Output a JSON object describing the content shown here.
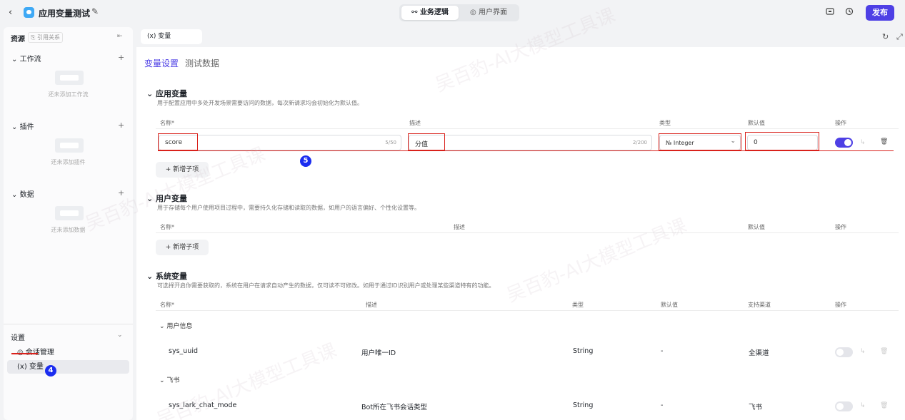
{
  "header": {
    "back_glyph": "‹",
    "app_title": "应用变量测试",
    "edit_glyph": "✎",
    "tabs": [
      {
        "icon": "⚯",
        "label": "业务逻辑"
      },
      {
        "icon": "◎",
        "label": "用户界面"
      }
    ],
    "publish_label": "发布",
    "icons": [
      "cloud-icon",
      "history-icon"
    ]
  },
  "sidebar": {
    "title": "资源",
    "ref_label": "⎘ 引用关系",
    "sections": [
      {
        "label": "工作流",
        "empty_text": "还未添加工作流"
      },
      {
        "label": "插件",
        "empty_text": "还未添加插件"
      },
      {
        "label": "数据",
        "empty_text": "还未添加数据"
      }
    ],
    "settings_title": "设置",
    "settings_items": [
      {
        "icon": "◎",
        "label": "会话管理"
      },
      {
        "icon": "(x)",
        "label": "变量"
      }
    ]
  },
  "badges": {
    "sidebar": "4",
    "row": "5"
  },
  "main": {
    "tab_label": "(x)  变量",
    "subtabs": [
      "变量设置",
      "测试数据"
    ],
    "app_vars": {
      "title": "应用变量",
      "desc": "用于配置应用中多处开发场景需要访问的数据，每次新请求均会初始化为默认值。",
      "columns": [
        "名称*",
        "描述",
        "类型",
        "默认值",
        "操作"
      ],
      "row": {
        "name": "score",
        "name_count": "5/50",
        "desc": "分值",
        "desc_count": "2/200",
        "type": "№ Integer",
        "default": "0",
        "enabled": true
      },
      "add_label": "+  新增子项"
    },
    "user_vars": {
      "title": "用户变量",
      "desc": "用于存储每个用户使用项目过程中，需要持久化存储和读取的数据，如用户的语言偏好、个性化设置等。",
      "columns": [
        "名称*",
        "描述",
        "默认值",
        "操作"
      ],
      "add_label": "+  新增子项"
    },
    "sys_vars": {
      "title": "系统变量",
      "desc": "可选择开启你需要获取的，系统在用户在请求自动产生的数据，仅可读不可修改。如用于通过ID识别用户或处理某些渠道特有的功能。",
      "columns": [
        "名称*",
        "描述",
        "类型",
        "默认值",
        "支持渠道",
        "操作"
      ],
      "groups": [
        {
          "title": "用户信息",
          "rows": [
            {
              "name": "sys_uuid",
              "desc": "用户唯一ID",
              "type": "String",
              "default": "-",
              "channel": "全渠道",
              "enabled": false
            }
          ]
        },
        {
          "title": "飞书",
          "rows": [
            {
              "name": "sys_lark_chat_mode",
              "desc": "Bot所在飞书会话类型",
              "type": "String",
              "default": "-",
              "channel": "飞书",
              "enabled": false
            }
          ]
        }
      ]
    }
  },
  "watermark": "吴百豹-AI大模型工具课"
}
